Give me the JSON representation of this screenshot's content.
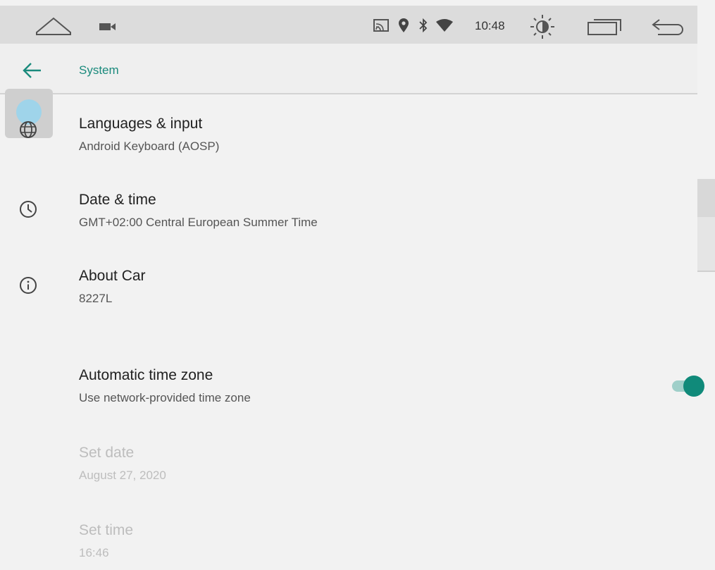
{
  "status_bar": {
    "time": "10:48",
    "icons": [
      "home-icon",
      "camera-icon",
      "cast-icon",
      "location-icon",
      "bluetooth-icon",
      "wifi-icon",
      "brightness-icon",
      "recent-apps-icon",
      "back-nav-icon"
    ]
  },
  "header": {
    "title": "System"
  },
  "items": [
    {
      "icon": "globe-icon",
      "title": "Languages & input",
      "summary": "Android Keyboard (AOSP)"
    },
    {
      "icon": "clock-icon",
      "title": "Date & time",
      "summary": "GMT+02:00 Central European Summer Time"
    },
    {
      "icon": "info-icon",
      "title": "About Car",
      "summary": "8227L"
    },
    {
      "title": "Automatic time zone",
      "summary": "Use network-provided time zone",
      "toggle_on": true
    },
    {
      "title": "Set date",
      "summary": "August 27, 2020",
      "disabled": true
    },
    {
      "title": "Set time",
      "summary": "16:46",
      "disabled": true
    }
  ],
  "colors": {
    "accent": "#1a8a7c",
    "toggle_thumb": "#108a7a",
    "toggle_track": "#9fcfc9",
    "status_bar": "#dcdcdc",
    "background": "#f2f2f2",
    "disabled_text": "#bdbdbd"
  }
}
